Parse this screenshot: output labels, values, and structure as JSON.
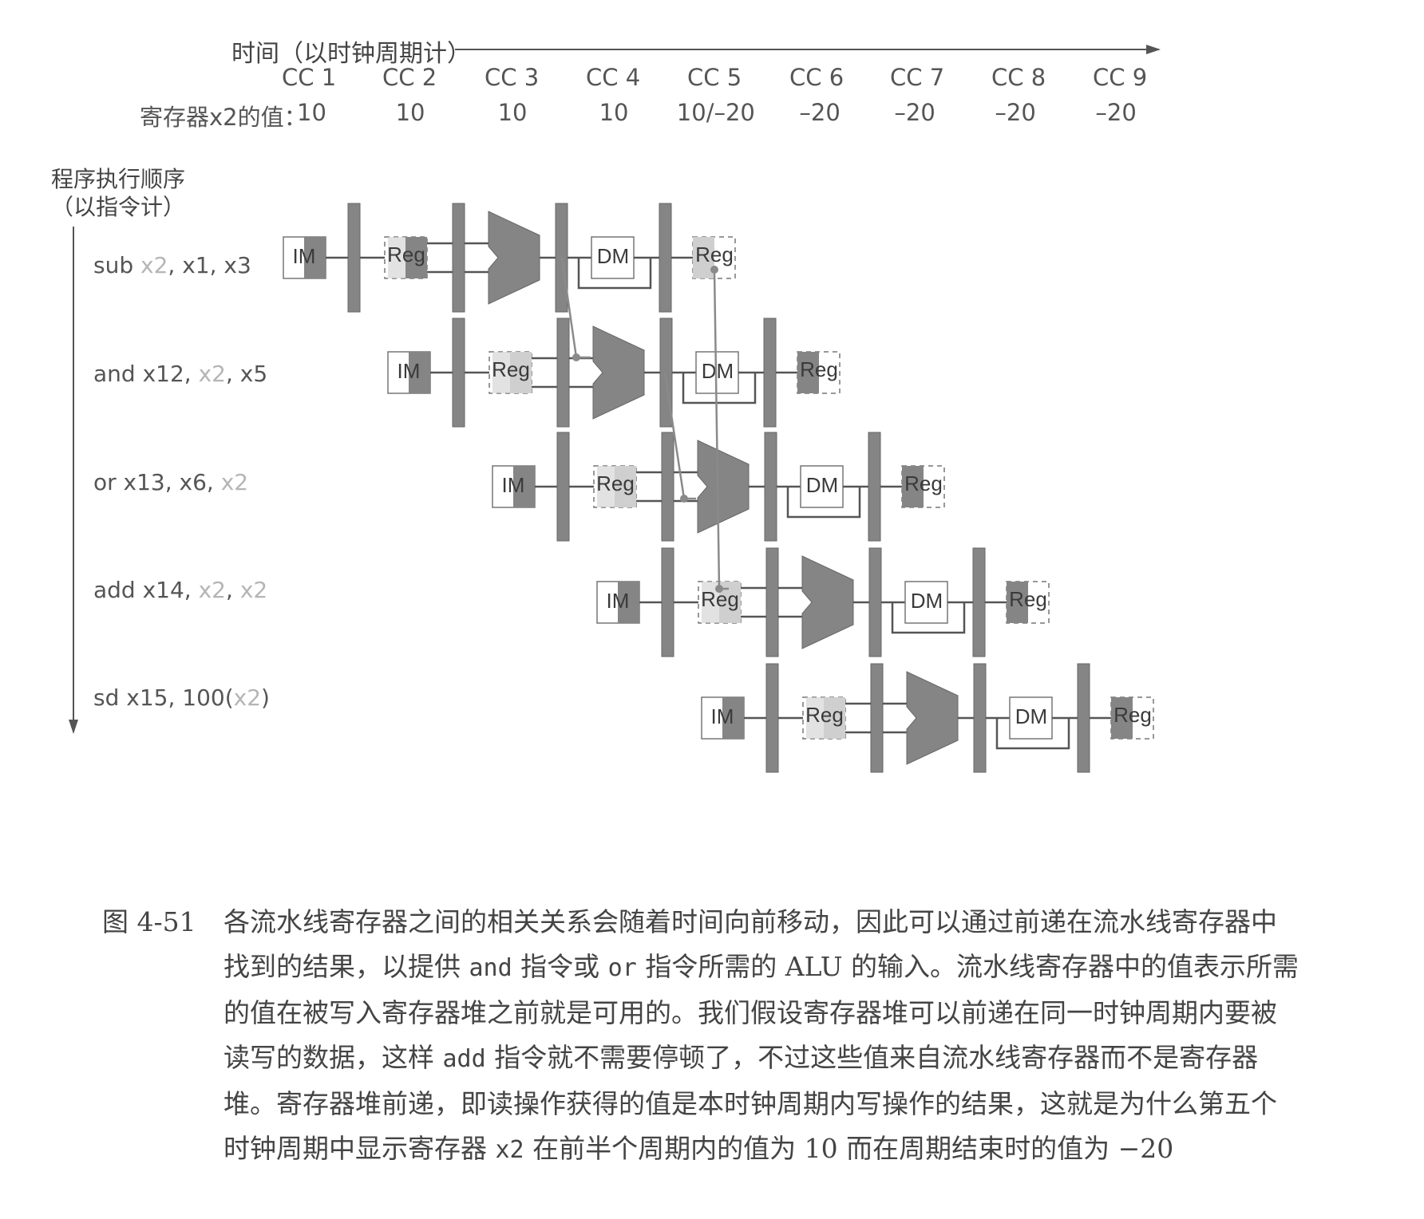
{
  "header": {
    "time_label": "时间（以时钟周期计）",
    "clock_cycles": [
      "CC 1",
      "CC 2",
      "CC 3",
      "CC 4",
      "CC 5",
      "CC 6",
      "CC 7",
      "CC 8",
      "CC 9"
    ],
    "register_value_label": "寄存器x2的值：",
    "register_values": [
      "10",
      "10",
      "10",
      "10",
      "10/–20",
      "–20",
      "–20",
      "–20",
      "–20"
    ]
  },
  "order_axis": {
    "line1": "程序执行顺序",
    "line2": "（以指令计）"
  },
  "instructions": [
    {
      "parts": [
        {
          "text": "sub ",
          "dim": false
        },
        {
          "text": "x2",
          "dim": true
        },
        {
          "text": ", x1, x3",
          "dim": false
        }
      ]
    },
    {
      "parts": [
        {
          "text": "and x12, ",
          "dim": false
        },
        {
          "text": "x2",
          "dim": true
        },
        {
          "text": ", x5",
          "dim": false
        }
      ]
    },
    {
      "parts": [
        {
          "text": "or x13, x6, ",
          "dim": false
        },
        {
          "text": "x2",
          "dim": true
        }
      ]
    },
    {
      "parts": [
        {
          "text": "add x14, ",
          "dim": false
        },
        {
          "text": "x2",
          "dim": true
        },
        {
          "text": ", ",
          "dim": false
        },
        {
          "text": "x2",
          "dim": true
        }
      ]
    },
    {
      "parts": [
        {
          "text": "sd x15, 100(",
          "dim": false
        },
        {
          "text": "x2",
          "dim": true
        },
        {
          "text": ")",
          "dim": false
        }
      ]
    }
  ],
  "stage_labels": {
    "im": "IM",
    "reg": "Reg",
    "dm": "DM"
  },
  "caption": {
    "number": "图 4-51",
    "segments": [
      {
        "text": "各流水线寄存器之间的相关关系会随着时间向前移动，因此可以通过前递在流水线寄存器中找到的结果，以提供 ",
        "mono": false
      },
      {
        "text": "and",
        "mono": true
      },
      {
        "text": " 指令或 ",
        "mono": false
      },
      {
        "text": "or",
        "mono": true
      },
      {
        "text": " 指令所需的 ALU 的输入。流水线寄存器中的值表示所需的值在被写入寄存器堆之前就是可用的。我们假设寄存器堆可以前递在同一时钟周期内要被读写的数据，这样 ",
        "mono": false
      },
      {
        "text": "add",
        "mono": true
      },
      {
        "text": " 指令就不需要停顿了，不过这些值来自流水线寄存器而不是寄存器堆。寄存器堆前递，即读操作获得的值是本时钟周期内写操作的结果，这就是为什么第五个时钟周期中显示寄存器 ",
        "mono": false
      },
      {
        "text": "x2",
        "mono": true
      },
      {
        "text": " 在前半个周期内的值为 10 而在周期结束时的值为 −20",
        "mono": false
      }
    ]
  },
  "colors": {
    "stage_dark": "#858585",
    "stage_light": "#cfcfcf",
    "line": "#555555",
    "forward": "#8a8a8a",
    "text": "#444444",
    "dim_text": "#b5b5b5"
  }
}
